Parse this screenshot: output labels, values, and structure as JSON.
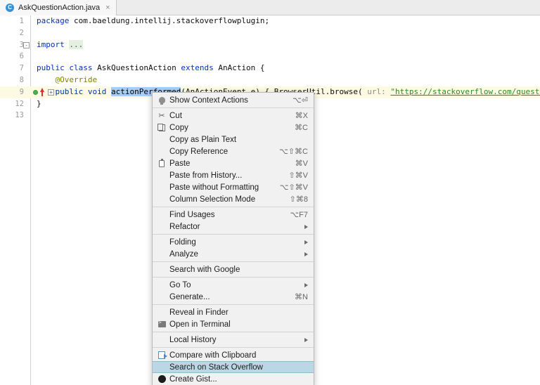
{
  "tab": {
    "icon": "java-class-icon",
    "icon_letter": "C",
    "filename": "AskQuestionAction.java",
    "close_glyph": "×"
  },
  "editor": {
    "lines": [
      {
        "num": "1",
        "highlight": false,
        "fold": false,
        "breakpoint": false,
        "tokens": [
          {
            "t": "kw",
            "v": "package"
          },
          {
            "t": "plain",
            "v": " com.baeldung.intellij.stackoverflowplugin;"
          }
        ]
      },
      {
        "num": "2",
        "highlight": false,
        "fold": false,
        "breakpoint": false,
        "tokens": []
      },
      {
        "num": "3",
        "highlight": false,
        "fold": true,
        "breakpoint": false,
        "fold_glyph": "-",
        "tokens": [
          {
            "t": "kw",
            "v": "import"
          },
          {
            "t": "plain",
            "v": " "
          },
          {
            "t": "fold",
            "v": "..."
          }
        ]
      },
      {
        "num": "6",
        "highlight": false,
        "fold": false,
        "breakpoint": false,
        "tokens": []
      },
      {
        "num": "7",
        "highlight": false,
        "fold": false,
        "breakpoint": false,
        "tokens": [
          {
            "t": "kw",
            "v": "public"
          },
          {
            "t": "plain",
            "v": " "
          },
          {
            "t": "kw",
            "v": "class"
          },
          {
            "t": "plain",
            "v": " AskQuestionAction "
          },
          {
            "t": "kw",
            "v": "extends"
          },
          {
            "t": "plain",
            "v": " AnAction {"
          }
        ]
      },
      {
        "num": "8",
        "highlight": false,
        "fold": false,
        "breakpoint": false,
        "tokens": [
          {
            "t": "plain",
            "v": "    "
          },
          {
            "t": "anno",
            "v": "@Override"
          }
        ]
      },
      {
        "num": "9",
        "highlight": true,
        "fold": true,
        "breakpoint": true,
        "fold_glyph": "+",
        "tokens": [
          {
            "t": "plain",
            "v": "    "
          },
          {
            "t": "kw",
            "v": "public"
          },
          {
            "t": "plain",
            "v": " "
          },
          {
            "t": "kw",
            "v": "void"
          },
          {
            "t": "plain",
            "v": " "
          },
          {
            "t": "sel",
            "v": "actionPerformed"
          },
          {
            "t": "plain",
            "v": "(AnActionEvent e) { BrowserUtil."
          },
          {
            "t": "ident",
            "v": "browse"
          },
          {
            "t": "plain",
            "v": "( "
          },
          {
            "t": "hint",
            "v": "url:"
          },
          {
            "t": "plain",
            "v": " "
          },
          {
            "t": "str",
            "v": "\"https://stackoverflow.com/questions/ask\""
          }
        ]
      },
      {
        "num": "12",
        "highlight": false,
        "fold": false,
        "breakpoint": false,
        "tokens": [
          {
            "t": "plain",
            "v": "}"
          }
        ]
      },
      {
        "num": "13",
        "highlight": false,
        "fold": false,
        "breakpoint": false,
        "tokens": []
      }
    ]
  },
  "context_menu": {
    "items": [
      {
        "label": "Show Context Actions",
        "shortcut": "⌥⏎",
        "icon": "lightbulb-icon",
        "submenu": false,
        "selected": false
      },
      {
        "separator": true
      },
      {
        "label": "Cut",
        "shortcut": "⌘X",
        "icon": "scissors-icon",
        "submenu": false,
        "selected": false
      },
      {
        "label": "Copy",
        "shortcut": "⌘C",
        "icon": "copy-icon",
        "submenu": false,
        "selected": false
      },
      {
        "label": "Copy as Plain Text",
        "shortcut": "",
        "icon": "",
        "submenu": false,
        "selected": false
      },
      {
        "label": "Copy Reference",
        "shortcut": "⌥⇧⌘C",
        "icon": "",
        "submenu": false,
        "selected": false
      },
      {
        "label": "Paste",
        "shortcut": "⌘V",
        "icon": "paste-icon",
        "submenu": false,
        "selected": false
      },
      {
        "label": "Paste from History...",
        "shortcut": "⇧⌘V",
        "icon": "",
        "submenu": false,
        "selected": false
      },
      {
        "label": "Paste without Formatting",
        "shortcut": "⌥⇧⌘V",
        "icon": "",
        "submenu": false,
        "selected": false
      },
      {
        "label": "Column Selection Mode",
        "shortcut": "⇧⌘8",
        "icon": "",
        "submenu": false,
        "selected": false
      },
      {
        "separator": true
      },
      {
        "label": "Find Usages",
        "shortcut": "⌥F7",
        "icon": "",
        "submenu": false,
        "selected": false
      },
      {
        "label": "Refactor",
        "shortcut": "",
        "icon": "",
        "submenu": true,
        "selected": false
      },
      {
        "separator": true
      },
      {
        "label": "Folding",
        "shortcut": "",
        "icon": "",
        "submenu": true,
        "selected": false
      },
      {
        "label": "Analyze",
        "shortcut": "",
        "icon": "",
        "submenu": true,
        "selected": false
      },
      {
        "separator": true
      },
      {
        "label": "Search with Google",
        "shortcut": "",
        "icon": "",
        "submenu": false,
        "selected": false
      },
      {
        "separator": true
      },
      {
        "label": "Go To",
        "shortcut": "",
        "icon": "",
        "submenu": true,
        "selected": false
      },
      {
        "label": "Generate...",
        "shortcut": "⌘N",
        "icon": "",
        "submenu": false,
        "selected": false
      },
      {
        "separator": true
      },
      {
        "label": "Reveal in Finder",
        "shortcut": "",
        "icon": "",
        "submenu": false,
        "selected": false
      },
      {
        "label": "Open in Terminal",
        "shortcut": "",
        "icon": "terminal-icon",
        "submenu": false,
        "selected": false
      },
      {
        "separator": true
      },
      {
        "label": "Local History",
        "shortcut": "",
        "icon": "",
        "submenu": true,
        "selected": false
      },
      {
        "separator": true
      },
      {
        "label": "Compare with Clipboard",
        "shortcut": "",
        "icon": "compare-icon",
        "submenu": false,
        "selected": false
      },
      {
        "label": "Search on Stack Overflow",
        "shortcut": "",
        "icon": "",
        "submenu": false,
        "selected": true
      },
      {
        "label": "Create Gist...",
        "shortcut": "",
        "icon": "github-icon",
        "submenu": false,
        "selected": false
      }
    ]
  },
  "colors": {
    "keyword": "#0033b3",
    "annotation": "#808000",
    "string": "#2a8a2a",
    "selection": "#a5cdf5",
    "menu_highlight": "#b9d7e4",
    "line_highlight": "#fcfae2",
    "tab_accent": "#3592d6"
  }
}
